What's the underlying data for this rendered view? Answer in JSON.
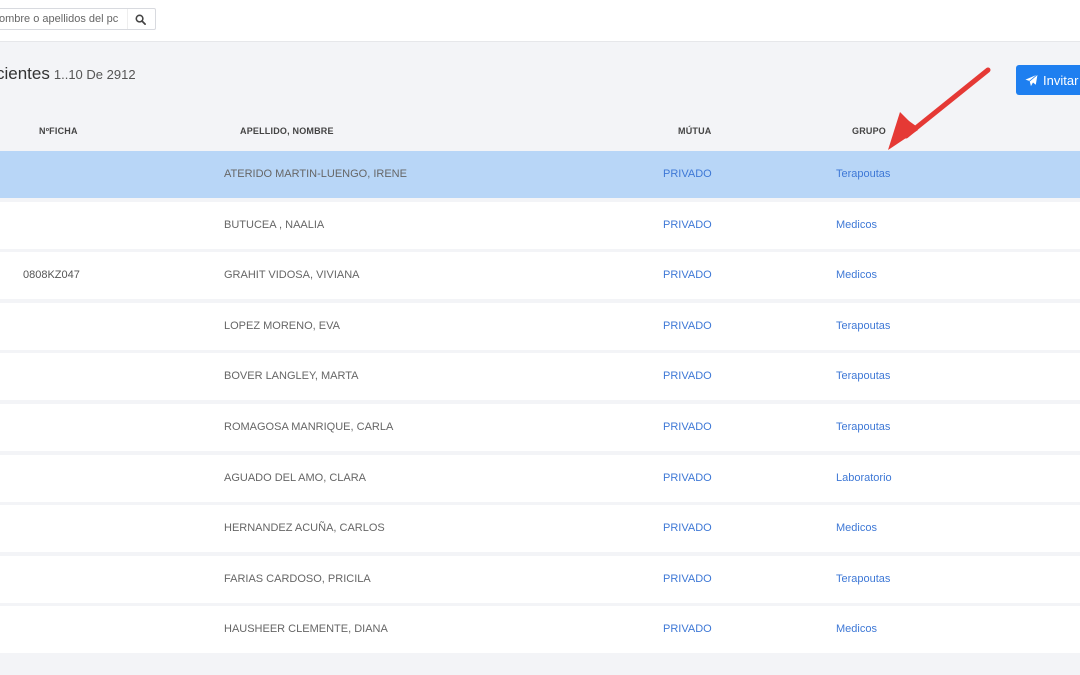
{
  "search": {
    "placeholder": "ombre o apellidos del pc"
  },
  "header": {
    "title": "cientes",
    "subtitle": "1..10 De 2912",
    "invite_label": "Invitar"
  },
  "table": {
    "columns": [
      "NºFICHA",
      "APELLIDO, NOMBRE",
      "MÚTUA",
      "GRUPO"
    ],
    "rows": [
      {
        "ficha": "",
        "name": "ATERIDO MARTIN-LUENGO, IRENE",
        "mutua": "PRIVADO",
        "grupo": "Terapoutas",
        "selected": true
      },
      {
        "ficha": "",
        "name": "BUTUCEA , NAALIA",
        "mutua": "PRIVADO",
        "grupo": "Medicos"
      },
      {
        "ficha": "0808KZ047",
        "name": "GRAHIT VIDOSA, VIVIANA",
        "mutua": "PRIVADO",
        "grupo": "Medicos"
      },
      {
        "ficha": "",
        "name": "LOPEZ MORENO, EVA",
        "mutua": "PRIVADO",
        "grupo": "Terapoutas"
      },
      {
        "ficha": "",
        "name": "BOVER LANGLEY, MARTA",
        "mutua": "PRIVADO",
        "grupo": "Terapoutas"
      },
      {
        "ficha": "",
        "name": "ROMAGOSA MANRIQUE, CARLA",
        "mutua": "PRIVADO",
        "grupo": "Terapoutas"
      },
      {
        "ficha": "",
        "name": "AGUADO DEL AMO, CLARA",
        "mutua": "PRIVADO",
        "grupo": "Laboratorio"
      },
      {
        "ficha": "",
        "name": "HERNANDEZ ACUÑA, CARLOS",
        "mutua": "PRIVADO",
        "grupo": "Medicos"
      },
      {
        "ficha": "",
        "name": "FARIAS CARDOSO, PRICILA",
        "mutua": "PRIVADO",
        "grupo": "Terapoutas"
      },
      {
        "ficha": "",
        "name": "HAUSHEER CLEMENTE, DIANA",
        "mutua": "PRIVADO",
        "grupo": "Medicos"
      }
    ]
  },
  "colors": {
    "accent": "#1e7ff0",
    "link": "#3e78d6",
    "selected_row": "#b8d6f7",
    "annotation_arrow": "#e53935"
  },
  "icons": {
    "search": "search-icon",
    "invite": "paper-plane-icon",
    "annotation": "red-arrow-annotation"
  }
}
